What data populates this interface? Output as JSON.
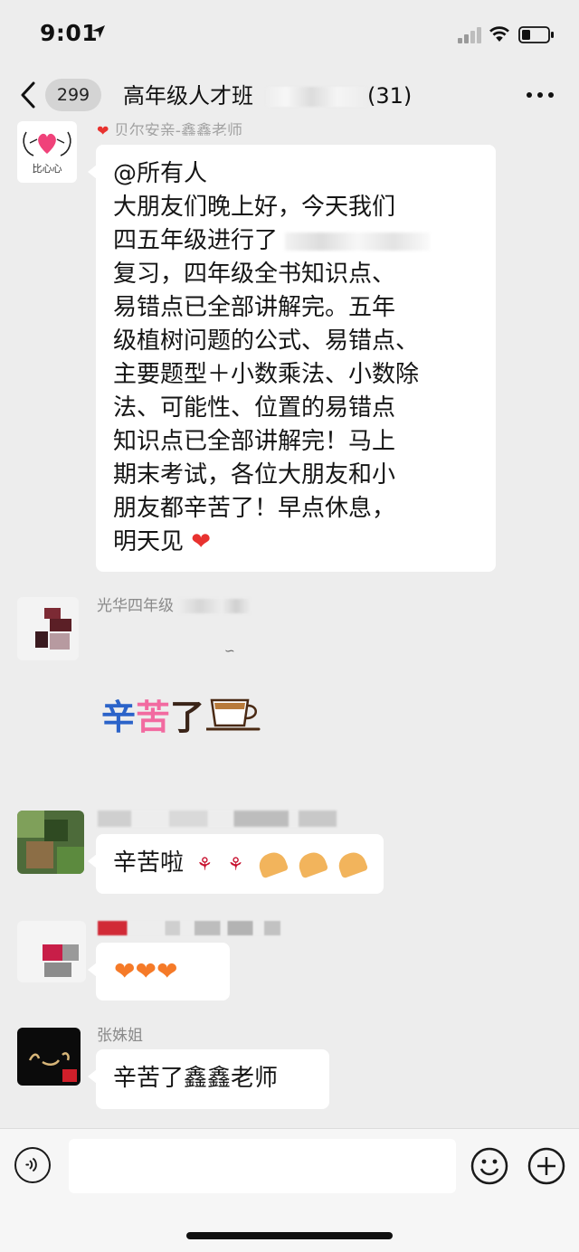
{
  "status_bar": {
    "time": "9:01"
  },
  "nav": {
    "unread_count": "299",
    "title_prefix": "高年级人才班",
    "title_suffix": "(31)"
  },
  "messages": [
    {
      "sender": "贝尔安亲-鑫鑫老师",
      "avatar_caption": "比心心",
      "lines": [
        "@所有人",
        "大朋友们晚上好，今天我们",
        "四五年级进行了"
      ],
      "lines_cont": [
        "复习，四年级全书知识点、",
        "易错点已全部讲解完。五年",
        "级植树问题的公式、易错点、",
        "主要题型＋小数乘法、小数除",
        "法、可能性、位置的易错点",
        "知识点已全部讲解完！马上",
        "期末考试，各位大朋友和小",
        "朋友都辛苦了！早点休息，"
      ],
      "last_line": "明天见"
    },
    {
      "sender": "光华四年级",
      "sticker_text": [
        "辛",
        "苦",
        "了"
      ]
    },
    {
      "text": "辛苦啦"
    },
    {
      "text": ""
    },
    {
      "sender": "张姝姐",
      "text": "辛苦了鑫鑫老师"
    }
  ],
  "input": {
    "placeholder": ""
  },
  "colors": {
    "background": "#ededed",
    "bubble": "#ffffff",
    "heart": "#e8322f",
    "orange_heart": "#f57a28"
  }
}
